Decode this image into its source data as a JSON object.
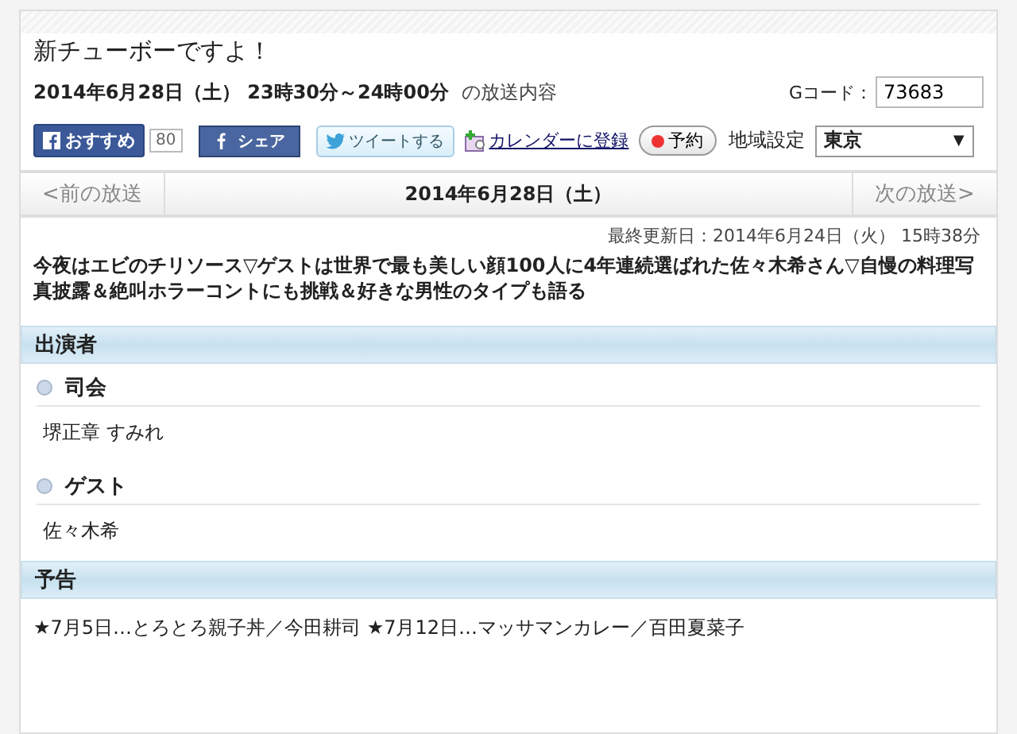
{
  "header": {
    "title": "新チューボーですよ！",
    "datetime": "2014年6月28日（土） 23時30分～24時00分",
    "suffix": "の放送内容",
    "gcode_label": "Gコード：",
    "gcode_value": "73683"
  },
  "social": {
    "recommend": "おすすめ",
    "recommend_count": "80",
    "share": "シェア",
    "tweet": "ツイートする",
    "calendar": "カレンダーに登録",
    "reserve": "予約",
    "region_label": "地域設定",
    "region_value": "東京",
    "region_caret": "▼"
  },
  "nav": {
    "prev": "<前の放送",
    "date": "2014年6月28日（土）",
    "next": "次の放送>"
  },
  "updated": "最終更新日：2014年6月24日（火） 15時38分",
  "description": "今夜はエビのチリソース▽ゲストは世界で最も美しい顔100人に4年連続選ばれた佐々木希さん▽自慢の料理写真披露＆絶叫ホラーコントにも挑戦＆好きな男性のタイプも語る",
  "cast": {
    "heading": "出演者",
    "groups": [
      {
        "role": "司会",
        "names": "堺正章 すみれ"
      },
      {
        "role": "ゲスト",
        "names": "佐々木希"
      }
    ]
  },
  "preview": {
    "heading": "予告",
    "text": "★7月5日…とろとろ親子丼／今田耕司 ★7月12日…マッサマンカレー／百田夏菜子"
  }
}
